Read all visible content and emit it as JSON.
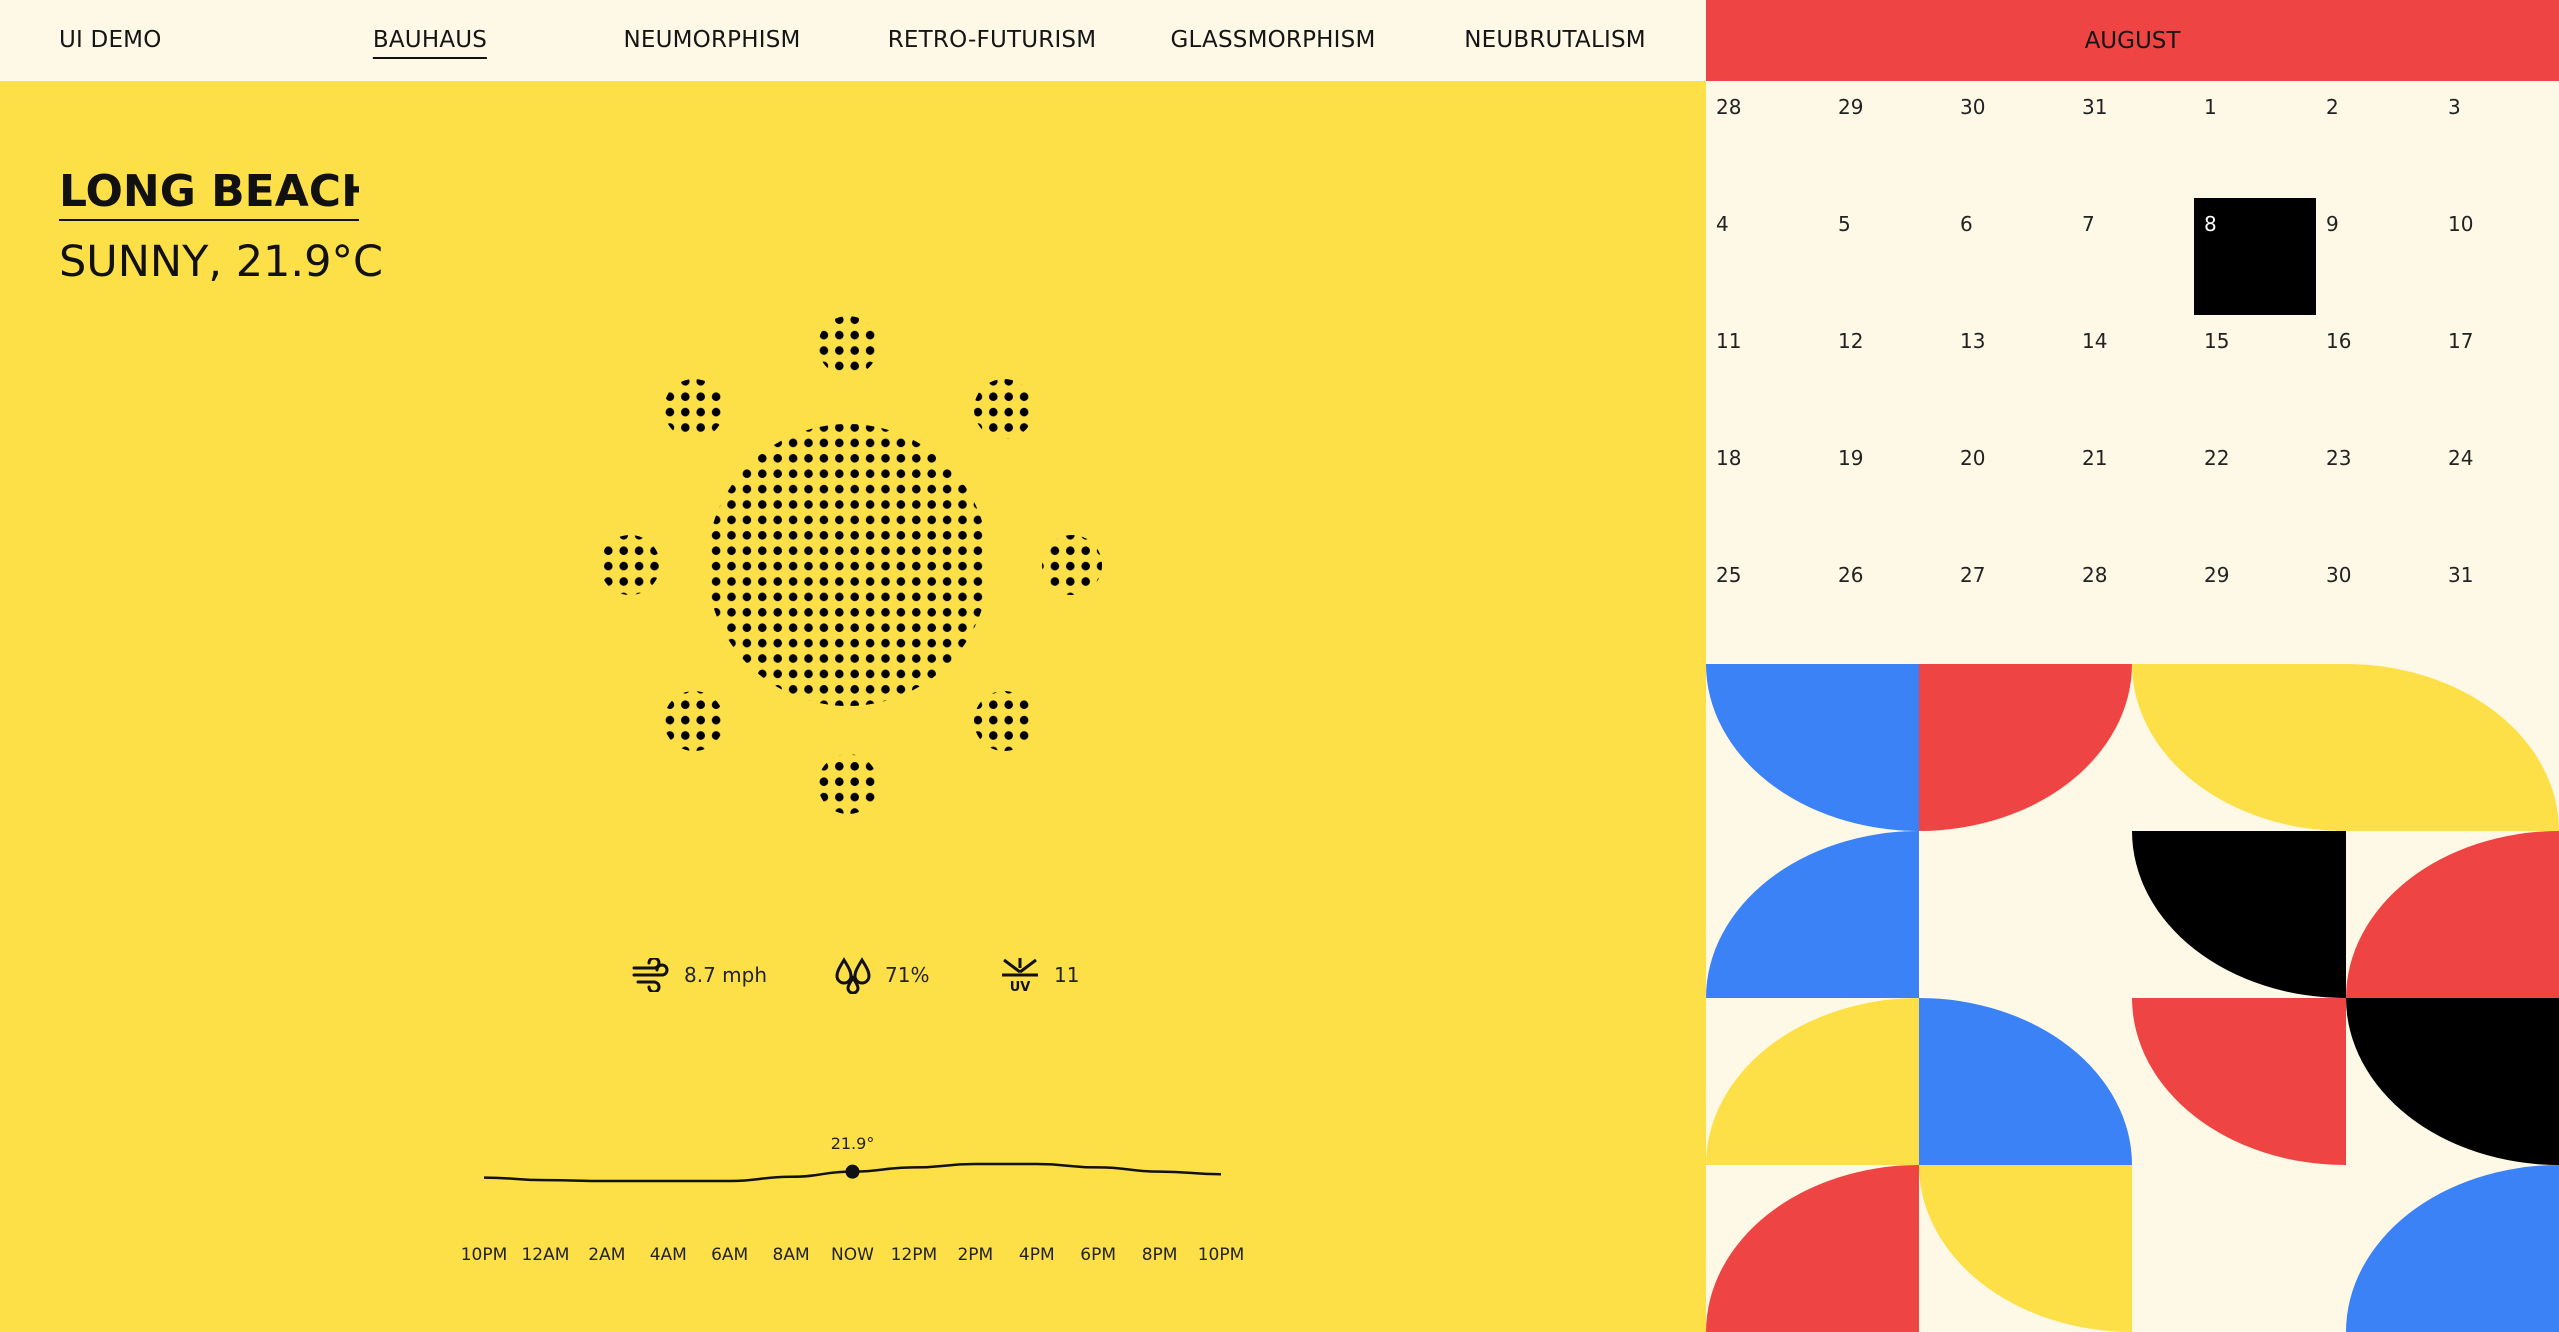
{
  "nav": {
    "brand": "UI DEMO",
    "items": [
      {
        "label": "BAUHAUS",
        "active": true
      },
      {
        "label": "NEUMORPHISM",
        "active": false
      },
      {
        "label": "RETRO-FUTURISM",
        "active": false
      },
      {
        "label": "GLASSMORPHISM",
        "active": false
      },
      {
        "label": "NEUBRUTALISM",
        "active": false
      }
    ]
  },
  "weather": {
    "city": "LONG BEACH",
    "condition": "SUNNY, 21.9°C",
    "icon": "dotted-sun-icon",
    "stats": {
      "wind": {
        "icon": "wind-icon",
        "value": "8.7 mph"
      },
      "humidity": {
        "icon": "humidity-drops-icon",
        "value": "71%"
      },
      "uv": {
        "icon": "uv-index-icon",
        "value": "11"
      }
    }
  },
  "chart_data": {
    "type": "line",
    "categories": [
      "10PM",
      "12AM",
      "2AM",
      "4AM",
      "6AM",
      "8AM",
      "NOW",
      "12PM",
      "2PM",
      "4PM",
      "6PM",
      "8PM",
      "10PM"
    ],
    "values": [
      21.2,
      20.9,
      20.8,
      20.8,
      20.8,
      21.3,
      21.9,
      22.4,
      22.8,
      22.8,
      22.4,
      21.9,
      21.6
    ],
    "highlight": {
      "index": 6,
      "label": "21.9°"
    }
  },
  "calendar": {
    "month": "AUGUST",
    "today": "8",
    "weeks": [
      [
        "28",
        "29",
        "30",
        "31",
        "1",
        "2",
        "3"
      ],
      [
        "4",
        "5",
        "6",
        "7",
        "8",
        "9",
        "10"
      ],
      [
        "11",
        "12",
        "13",
        "14",
        "15",
        "16",
        "17"
      ],
      [
        "18",
        "19",
        "20",
        "21",
        "22",
        "23",
        "24"
      ],
      [
        "25",
        "26",
        "27",
        "28",
        "29",
        "30",
        "31"
      ]
    ]
  },
  "colors": {
    "yellow": "#fde047",
    "red": "#ef4444",
    "blue": "#3b82f6",
    "black": "#000000",
    "cream": "#fdf9e6"
  }
}
